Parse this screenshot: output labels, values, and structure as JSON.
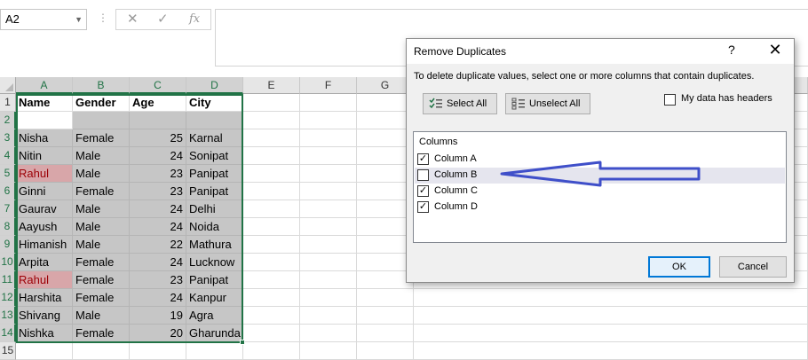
{
  "namebox": {
    "value": "A2",
    "dropdown_icon": "chevron-down-icon"
  },
  "formula_bar": {
    "dots": "⋮",
    "cancel_icon": "✕",
    "enter_icon": "✓",
    "function_icon": "fx"
  },
  "columns": [
    "A",
    "B",
    "C",
    "D",
    "E",
    "F",
    "G"
  ],
  "rows": [
    {
      "num": "1",
      "cells": [
        "Name",
        "Gender",
        "Age",
        "City"
      ]
    },
    {
      "num": "2",
      "cells": [
        "",
        "",
        "",
        ""
      ]
    },
    {
      "num": "3",
      "cells": [
        "Nisha",
        "Female",
        "25",
        "Karnal"
      ]
    },
    {
      "num": "4",
      "cells": [
        "Nitin",
        "Male",
        "24",
        "Sonipat"
      ]
    },
    {
      "num": "5",
      "cells": [
        "Rahul",
        "Male",
        "23",
        "Panipat"
      ]
    },
    {
      "num": "6",
      "cells": [
        "Ginni",
        "Female",
        "23",
        "Panipat"
      ]
    },
    {
      "num": "7",
      "cells": [
        "Gaurav",
        "Male",
        "24",
        "Delhi"
      ]
    },
    {
      "num": "8",
      "cells": [
        "Aayush",
        "Male",
        "24",
        "Noida"
      ]
    },
    {
      "num": "9",
      "cells": [
        "Himanish",
        "Male",
        "22",
        "Mathura"
      ]
    },
    {
      "num": "10",
      "cells": [
        "Arpita",
        "Female",
        "24",
        "Lucknow"
      ]
    },
    {
      "num": "11",
      "cells": [
        "Rahul",
        "Female",
        "23",
        "Panipat"
      ]
    },
    {
      "num": "12",
      "cells": [
        "Harshita",
        "Female",
        "24",
        "Kanpur"
      ]
    },
    {
      "num": "13",
      "cells": [
        "Shivang",
        "Male",
        "19",
        "Agra"
      ]
    },
    {
      "num": "14",
      "cells": [
        "Nishka",
        "Female",
        "20",
        "Gharunda"
      ]
    },
    {
      "num": "15",
      "cells": [
        "",
        "",
        "",
        ""
      ]
    }
  ],
  "highlight_color": "#d8a6a9",
  "selection_color": "#217346",
  "dialog": {
    "title": "Remove Duplicates",
    "help": "?",
    "close": "✕",
    "instruction": "To delete duplicate values, select one or more columns that contain duplicates.",
    "select_all": "Select All",
    "unselect_all": "Unselect All",
    "has_headers_label": "My data has headers",
    "has_headers_checked": false,
    "columns_title": "Columns",
    "column_items": [
      {
        "label": "Column A",
        "checked": true
      },
      {
        "label": "Column B",
        "checked": false
      },
      {
        "label": "Column C",
        "checked": true
      },
      {
        "label": "Column D",
        "checked": true
      }
    ],
    "ok": "OK",
    "cancel": "Cancel"
  },
  "annotation": {
    "arrow_color": "#3f4fc9",
    "points_to": "Column B"
  }
}
